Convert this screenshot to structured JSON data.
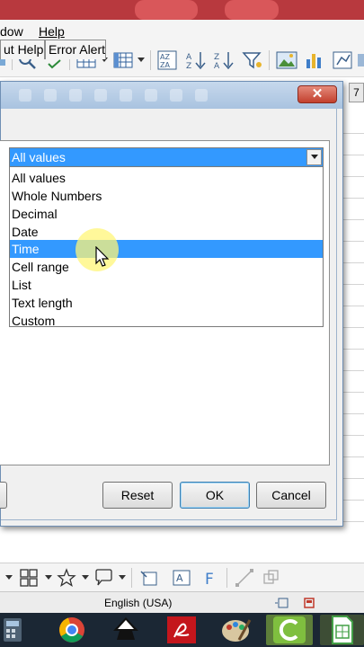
{
  "menu": {
    "items": [
      {
        "label": "dow",
        "underline": false
      },
      {
        "label": "Help",
        "underline": true
      }
    ]
  },
  "sheet": {
    "column_header": "7"
  },
  "dialog": {
    "close_glyph": "✕",
    "tabs": [
      "ut Help",
      "Error Alert"
    ],
    "allow": {
      "selected": "All values",
      "options": [
        "All values",
        "Whole Numbers",
        "Decimal",
        "Date",
        "Time",
        "Cell range",
        "List",
        "Text length",
        "Custom"
      ],
      "highlighted": "Time"
    },
    "buttons": {
      "reset": "Reset",
      "ok": "OK",
      "cancel": "Cancel"
    }
  },
  "statusbar": {
    "language": "English (USA)"
  },
  "icons": {
    "toolbar": [
      "find-replace-icon",
      "spelling-icon",
      "rows-icon",
      "columns-icon",
      "sort-icon",
      "sort-ascending-icon",
      "sort-descending-icon",
      "autofilter-icon",
      "image-icon",
      "chart-icon",
      "pivot-table-icon"
    ],
    "taskbar": [
      "calculator-icon",
      "chrome-icon",
      "inkscape-icon",
      "acrobat-icon",
      "paint-icon",
      "camtasia-icon",
      "calc-document-icon"
    ]
  },
  "colors": {
    "selection": "#3399ff",
    "title_close": "#c2402e",
    "taskbar": "#1b2734"
  }
}
